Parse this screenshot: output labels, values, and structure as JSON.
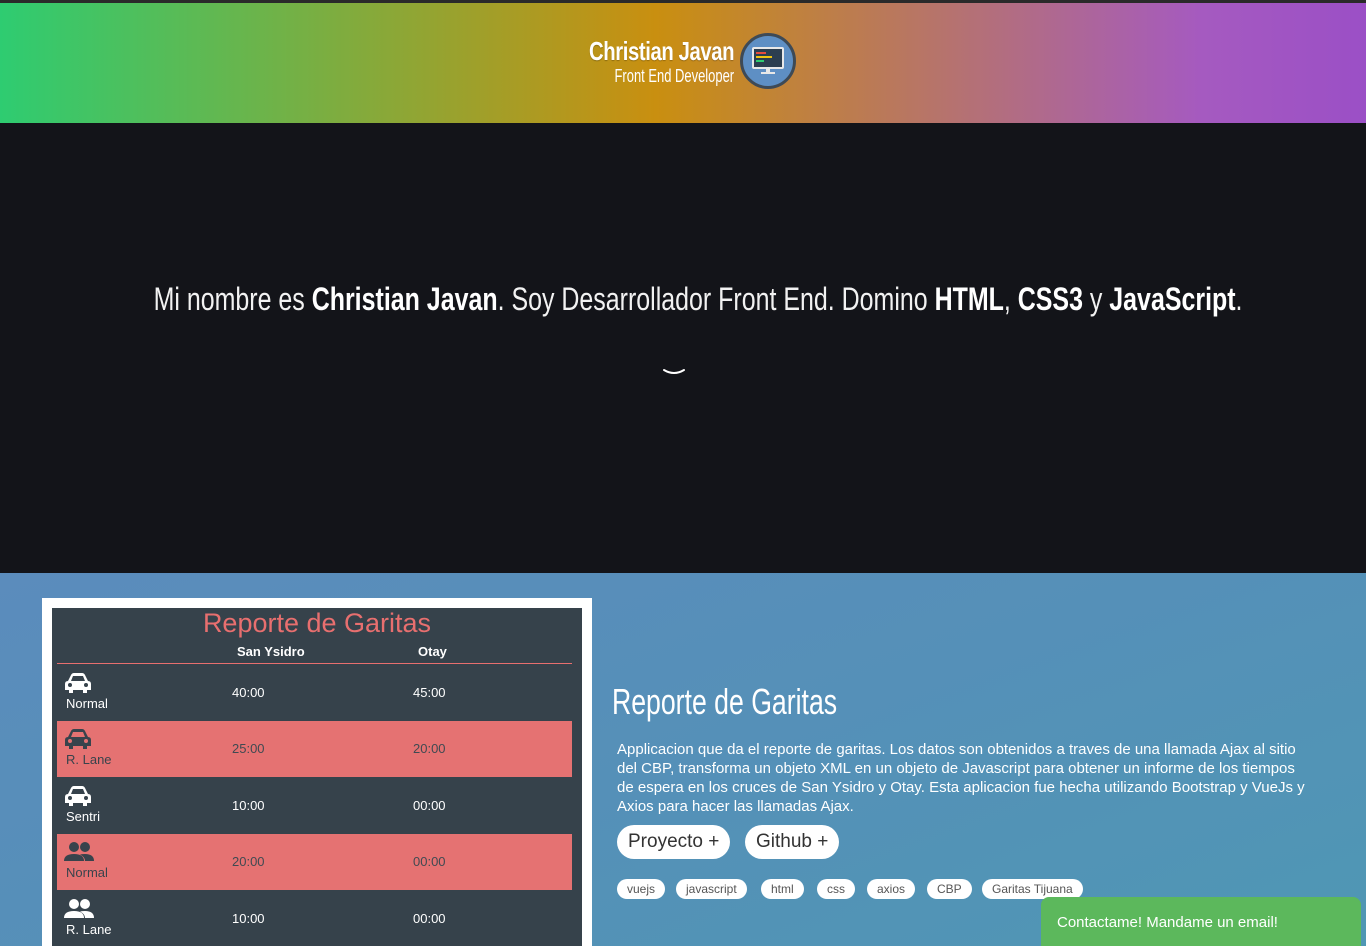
{
  "header": {
    "name": "Christian Javan",
    "role": "Front End Developer",
    "avatar_icon": "monitor-code-icon"
  },
  "hero": {
    "part1": "Mi nombre es ",
    "name": "Christian Javan",
    "part2": ". Soy Desarrollador Front End. Domino ",
    "skill1": "HTML",
    "sep1": ", ",
    "skill2": "CSS3",
    "sep2": " y ",
    "skill3": "JavaScript",
    "end": ".",
    "scroll_icon": "chevron-down-icon"
  },
  "screenshot": {
    "title": "Reporte de Garitas",
    "col1": "San Ysidro",
    "col2": "Otay",
    "rows": [
      {
        "icon": "car-icon",
        "label": "Normal",
        "v1": "40:00",
        "v2": "45:00"
      },
      {
        "icon": "car-icon",
        "label": "R. Lane",
        "v1": "25:00",
        "v2": "20:00"
      },
      {
        "icon": "car-icon",
        "label": "Sentri",
        "v1": "10:00",
        "v2": "00:00"
      },
      {
        "icon": "people-icon",
        "label": "Normal",
        "v1": "20:00",
        "v2": "00:00"
      },
      {
        "icon": "people-icon",
        "label": "R. Lane",
        "v1": "10:00",
        "v2": "00:00"
      }
    ]
  },
  "project": {
    "title": "Reporte de Garitas",
    "description": "Applicacion que da el reporte de garitas. Los datos son obtenidos a traves de una llamada Ajax al sitio del CBP, transforma un objeto XML en un objeto de Javascript para obtener un informe de los tiempos de espera en los cruces de San Ysidro y Otay. Esta aplicacion fue hecha utilizando Bootstrap y VueJs y Axios para hacer las llamadas Ajax.",
    "buttons": [
      "Proyecto +",
      "Github +"
    ],
    "tags": [
      "vuejs",
      "javascript",
      "html",
      "css",
      "axios",
      "CBP",
      "Garitas Tijuana"
    ]
  },
  "contact": {
    "label": "Contactame! Mandame un email!"
  },
  "colors": {
    "accent_green": "#5cb85c",
    "coral": "#e57272",
    "dark": "#131419"
  }
}
